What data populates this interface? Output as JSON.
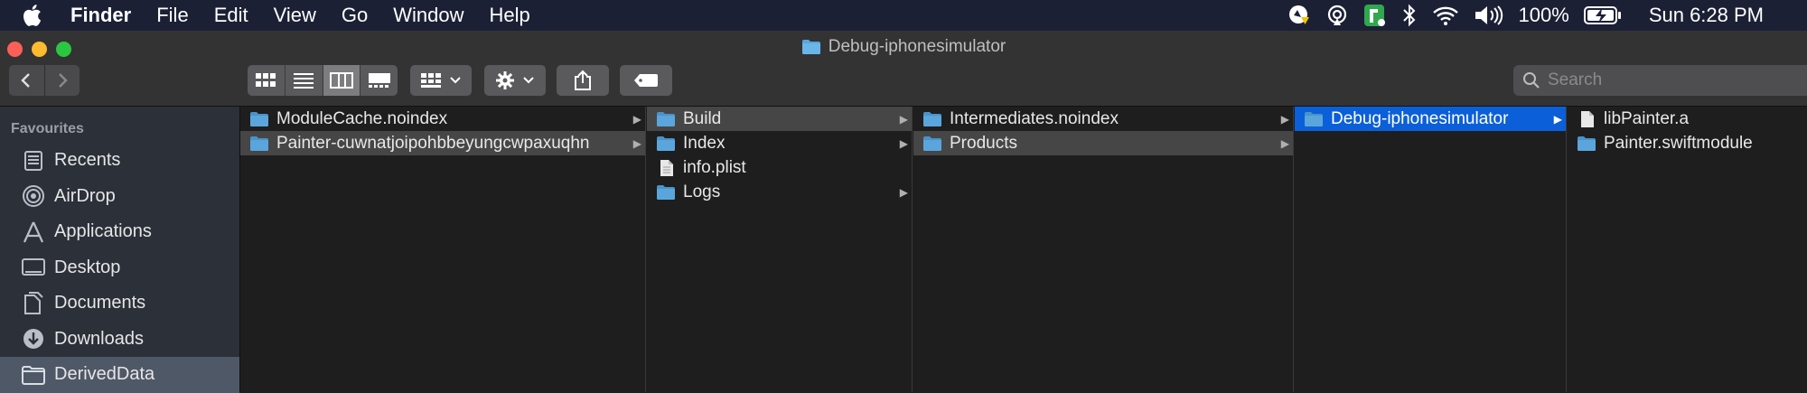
{
  "menubar": {
    "app": "Finder",
    "items": [
      "File",
      "Edit",
      "View",
      "Go",
      "Window",
      "Help"
    ],
    "battery": "100%",
    "clock": "Sun 6:28 PM",
    "status_icons": [
      "avast-icon",
      "airplay-icon",
      "app-icon",
      "bluetooth-icon",
      "wifi-icon",
      "volume-icon",
      "battery-icon"
    ]
  },
  "window": {
    "title": "Debug-iphonesimulator"
  },
  "toolbar": {
    "search_placeholder": "Search"
  },
  "sidebar": {
    "heading": "Favourites",
    "items": [
      {
        "label": "Recents",
        "icon": "recents-icon"
      },
      {
        "label": "AirDrop",
        "icon": "airdrop-icon"
      },
      {
        "label": "Applications",
        "icon": "applications-icon"
      },
      {
        "label": "Desktop",
        "icon": "desktop-icon"
      },
      {
        "label": "Documents",
        "icon": "documents-icon"
      },
      {
        "label": "Downloads",
        "icon": "downloads-icon"
      },
      {
        "label": "DerivedData",
        "icon": "folder-icon",
        "selected": true
      }
    ]
  },
  "columns": [
    {
      "items": [
        {
          "name": "ModuleCache.noindex",
          "type": "folder",
          "has_children": true
        },
        {
          "name": "Painter-cuwnatjoipohbbeyungcwpaxuqhn",
          "type": "folder",
          "has_children": true,
          "selected": "gray"
        }
      ]
    },
    {
      "items": [
        {
          "name": "Build",
          "type": "folder",
          "has_children": true,
          "selected": "gray"
        },
        {
          "name": "Index",
          "type": "folder",
          "has_children": true
        },
        {
          "name": "info.plist",
          "type": "file",
          "has_children": false
        },
        {
          "name": "Logs",
          "type": "folder",
          "has_children": true
        }
      ]
    },
    {
      "items": [
        {
          "name": "Intermediates.noindex",
          "type": "folder",
          "has_children": true
        },
        {
          "name": "Products",
          "type": "folder",
          "has_children": true,
          "selected": "gray"
        }
      ]
    },
    {
      "items": [
        {
          "name": "Debug-iphonesimulator",
          "type": "folder",
          "has_children": true,
          "selected": "blue"
        }
      ]
    },
    {
      "items": [
        {
          "name": "libPainter.a",
          "type": "file",
          "has_children": false
        },
        {
          "name": "Painter.swiftmodule",
          "type": "folder",
          "has_children": false
        }
      ]
    }
  ],
  "colors": {
    "accent": "#0b5fd8",
    "folder": "#5aa6dc",
    "menubar": "#1b2035",
    "sidebar": "#2b3039"
  }
}
